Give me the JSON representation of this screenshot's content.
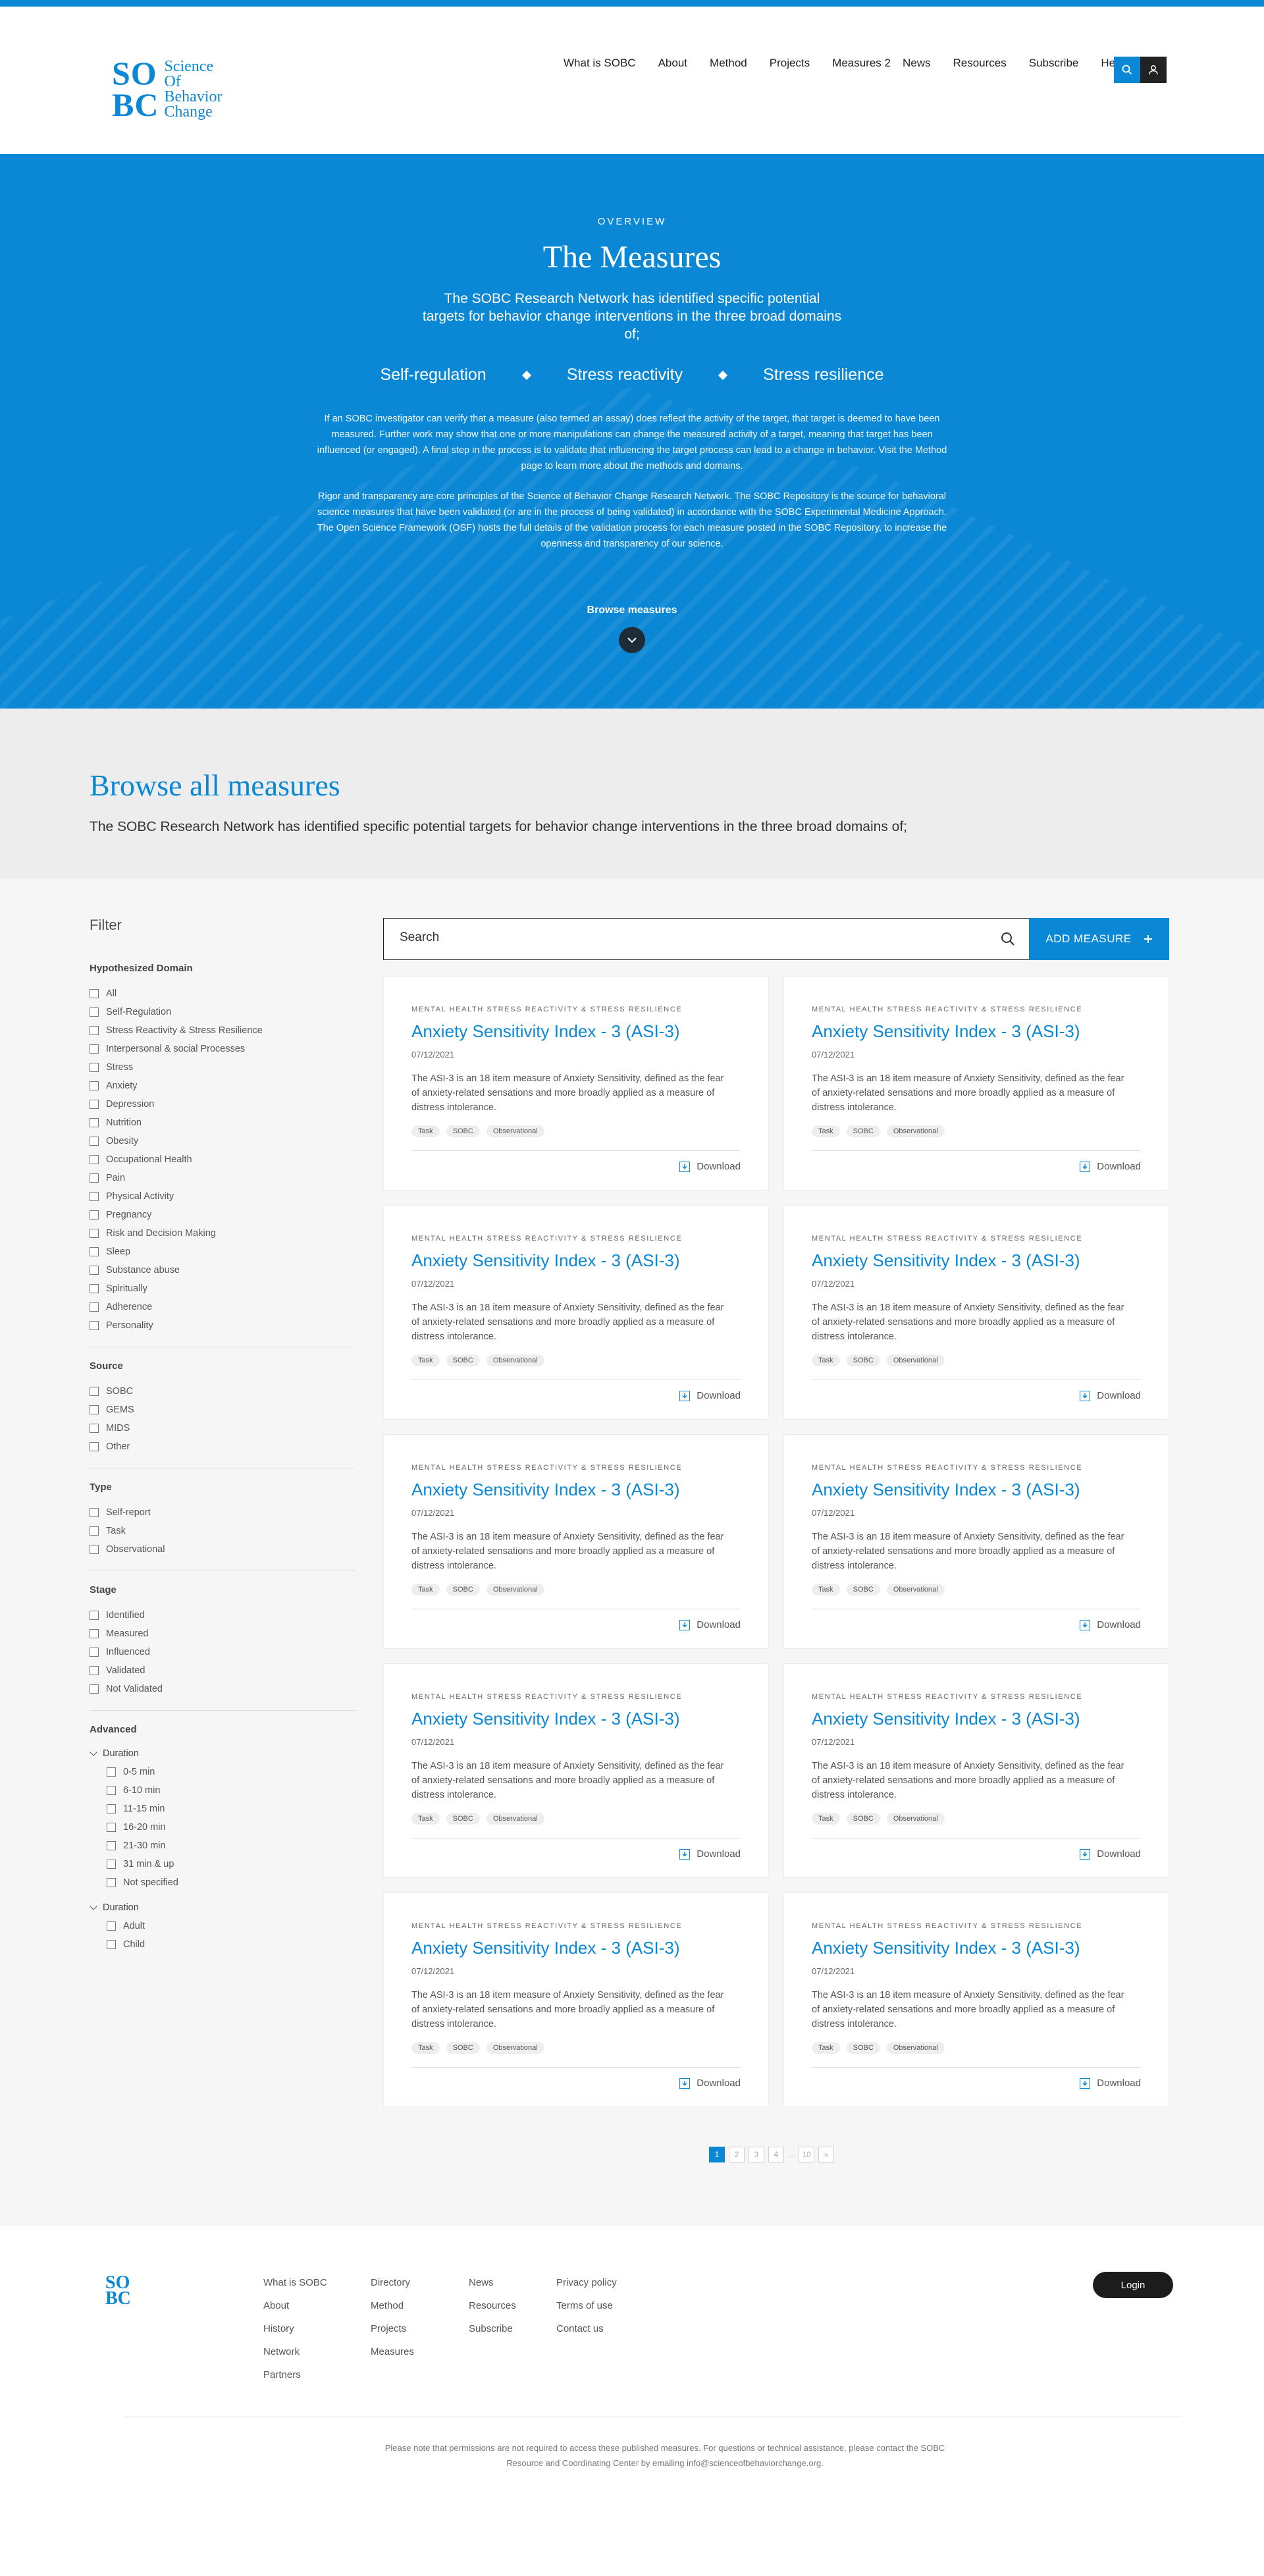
{
  "header": {
    "logo": {
      "mono_top": "SO",
      "mono_bottom": "BC",
      "words": [
        "Science",
        "Of",
        "Behavior",
        "Change"
      ]
    },
    "nav": [
      "What is SOBC",
      "About",
      "Method",
      "Projects",
      "Measures 2",
      "News",
      "Resources",
      "Subscribe",
      "Help"
    ],
    "icons": [
      "search-icon",
      "user-icon"
    ],
    "colors": {
      "accent": "#0a88d6",
      "dark": "#222222"
    }
  },
  "hero": {
    "eyebrow": "OVERVIEW",
    "title": "The Measures",
    "lead": "The SOBC Research Network has identified specific potential targets for behavior change interventions in the three broad domains of;",
    "domains": [
      "Self-regulation",
      "Stress reactivity",
      "Stress resilience"
    ],
    "body1": "If an SOBC investigator can verify that a measure (also termed an assay) does reflect the activity of the target, that target is deemed to have been measured. Further work may show that one or more manipulations can change the measured activity of a target, meaning that target has been influenced (or engaged). A final step in the process is to validate that influencing the target process can lead to a change in behavior. Visit the Method page to learn more about the methods and domains.",
    "body2": "Rigor and transparency are core principles of the Science of Behavior Change Research Network. The SOBC Repository is the source for behavioral science measures that have been validated (or are in the process of being validated) in accordance with the SOBC Experimental Medicine Approach. The Open Science Framework (OSF) hosts the full details of the validation process for each measure posted in the SOBC Repository, to increase the openness and transparency of our science.",
    "browse_link": "Browse measures"
  },
  "browse": {
    "title": "Browse all measures",
    "subtitle": "The SOBC Research Network has identified specific potential targets for behavior change interventions in the three broad domains of;"
  },
  "filter": {
    "title": "Filter",
    "domain": {
      "title": "Hypothesized Domain",
      "items": [
        "All",
        "Self-Regulation",
        "Stress Reactivity & Stress Resilience",
        "Interpersonal & social Processes",
        "Stress",
        "Anxiety",
        "Depression",
        "Nutrition",
        "Obesity",
        "Occupational Health",
        "Pain",
        "Physical Activity",
        "Pregnancy",
        "Risk and Decision Making",
        "Sleep",
        "Substance abuse",
        "Spiritually",
        "Adherence",
        "Personality"
      ]
    },
    "source": {
      "title": "Source",
      "items": [
        "SOBC",
        "GEMS",
        "MIDS",
        "Other"
      ]
    },
    "type": {
      "title": "Type",
      "items": [
        "Self-report",
        "Task",
        "Observational"
      ]
    },
    "stage": {
      "title": "Stage",
      "items": [
        "Identified",
        "Measured",
        "Influenced",
        "Validated",
        "Not Validated"
      ]
    },
    "advanced": {
      "title": "Advanced",
      "duration1": {
        "title": "Duration",
        "items": [
          "0-5 min",
          "6-10 min",
          "11-15 min",
          "16-20 min",
          "21-30 min",
          "31 min & up",
          "Not specified"
        ]
      },
      "duration2": {
        "title": "Duration",
        "items": [
          "Adult",
          "Child"
        ]
      }
    }
  },
  "search": {
    "placeholder": "Search",
    "add_label": "ADD MEASURE"
  },
  "cards": [
    {
      "category": "MENTAL HEALTH STRESS REACTIVITY & STRESS RESILIENCE",
      "title": "Anxiety Sensitivity Index - 3 (ASI-3)",
      "date": "07/12/2021",
      "desc": "The ASI-3 is an 18 item measure of Anxiety Sensitivity, defined as the fear of anxiety-related sensations and more broadly applied as a measure of distress intolerance.",
      "tags": [
        "Task",
        "SOBC",
        "Observational"
      ],
      "download": "Download"
    },
    {
      "category": "MENTAL HEALTH STRESS REACTIVITY & STRESS RESILIENCE",
      "title": "Anxiety Sensitivity Index - 3 (ASI-3)",
      "date": "07/12/2021",
      "desc": "The ASI-3 is an 18 item measure of Anxiety Sensitivity, defined as the fear of anxiety-related sensations and more broadly applied as a measure of distress intolerance.",
      "tags": [
        "Task",
        "SOBC",
        "Observational"
      ],
      "download": "Download"
    },
    {
      "category": "MENTAL HEALTH STRESS REACTIVITY & STRESS RESILIENCE",
      "title": "Anxiety Sensitivity Index - 3 (ASI-3)",
      "date": "07/12/2021",
      "desc": "The ASI-3 is an 18 item measure of Anxiety Sensitivity, defined as the fear of anxiety-related sensations and more broadly applied as a measure of distress intolerance.",
      "tags": [
        "Task",
        "SOBC",
        "Observational"
      ],
      "download": "Download"
    },
    {
      "category": "MENTAL HEALTH STRESS REACTIVITY & STRESS RESILIENCE",
      "title": "Anxiety Sensitivity Index - 3 (ASI-3)",
      "date": "07/12/2021",
      "desc": "The ASI-3 is an 18 item measure of Anxiety Sensitivity, defined as the fear of anxiety-related sensations and more broadly applied as a measure of distress intolerance.",
      "tags": [
        "Task",
        "SOBC",
        "Observational"
      ],
      "download": "Download"
    },
    {
      "category": "MENTAL HEALTH STRESS REACTIVITY & STRESS RESILIENCE",
      "title": "Anxiety Sensitivity Index - 3 (ASI-3)",
      "date": "07/12/2021",
      "desc": "The ASI-3 is an 18 item measure of Anxiety Sensitivity, defined as the fear of anxiety-related sensations and more broadly applied as a measure of distress intolerance.",
      "tags": [
        "Task",
        "SOBC",
        "Observational"
      ],
      "download": "Download"
    },
    {
      "category": "MENTAL HEALTH STRESS REACTIVITY & STRESS RESILIENCE",
      "title": "Anxiety Sensitivity Index - 3 (ASI-3)",
      "date": "07/12/2021",
      "desc": "The ASI-3 is an 18 item measure of Anxiety Sensitivity, defined as the fear of anxiety-related sensations and more broadly applied as a measure of distress intolerance.",
      "tags": [
        "Task",
        "SOBC",
        "Observational"
      ],
      "download": "Download"
    },
    {
      "category": "MENTAL HEALTH STRESS REACTIVITY & STRESS RESILIENCE",
      "title": "Anxiety Sensitivity Index - 3 (ASI-3)",
      "date": "07/12/2021",
      "desc": "The ASI-3 is an 18 item measure of Anxiety Sensitivity, defined as the fear of anxiety-related sensations and more broadly applied as a measure of distress intolerance.",
      "tags": [
        "Task",
        "SOBC",
        "Observational"
      ],
      "download": "Download"
    },
    {
      "category": "MENTAL HEALTH STRESS REACTIVITY & STRESS RESILIENCE",
      "title": "Anxiety Sensitivity Index - 3 (ASI-3)",
      "date": "07/12/2021",
      "desc": "The ASI-3 is an 18 item measure of Anxiety Sensitivity, defined as the fear of anxiety-related sensations and more broadly applied as a measure of distress intolerance.",
      "tags": [
        "Task",
        "SOBC",
        "Observational"
      ],
      "download": "Download"
    },
    {
      "category": "MENTAL HEALTH STRESS REACTIVITY & STRESS RESILIENCE",
      "title": "Anxiety Sensitivity Index - 3 (ASI-3)",
      "date": "07/12/2021",
      "desc": "The ASI-3 is an 18 item measure of Anxiety Sensitivity, defined as the fear of anxiety-related sensations and more broadly applied as a measure of distress intolerance.",
      "tags": [
        "Task",
        "SOBC",
        "Observational"
      ],
      "download": "Download"
    },
    {
      "category": "MENTAL HEALTH STRESS REACTIVITY & STRESS RESILIENCE",
      "title": "Anxiety Sensitivity Index - 3 (ASI-3)",
      "date": "07/12/2021",
      "desc": "The ASI-3 is an 18 item measure of Anxiety Sensitivity, defined as the fear of anxiety-related sensations and more broadly applied as a measure of distress intolerance.",
      "tags": [
        "Task",
        "SOBC",
        "Observational"
      ],
      "download": "Download"
    }
  ],
  "pagination": {
    "pages": [
      "1",
      "2",
      "3",
      "4"
    ],
    "last": "10",
    "next": "»",
    "current": "1"
  },
  "footer": {
    "logo": {
      "top": "SO",
      "bottom": "BC"
    },
    "col1": [
      "What is SOBC",
      "About",
      "History",
      "Network",
      "Partners"
    ],
    "col2": [
      "Directory",
      "Method",
      "Projects",
      "Measures"
    ],
    "col3": [
      "News",
      "Resources",
      "Subscribe"
    ],
    "col4": [
      "Privacy policy",
      "Terms of use",
      "Contact us"
    ],
    "login": "Login",
    "note": "Please note that permissions are not required to access these published measures. For questions or technical assistance, please contact the SOBC Resource and Coordinating Center by emailing info@scienceofbehaviorchange.org."
  }
}
